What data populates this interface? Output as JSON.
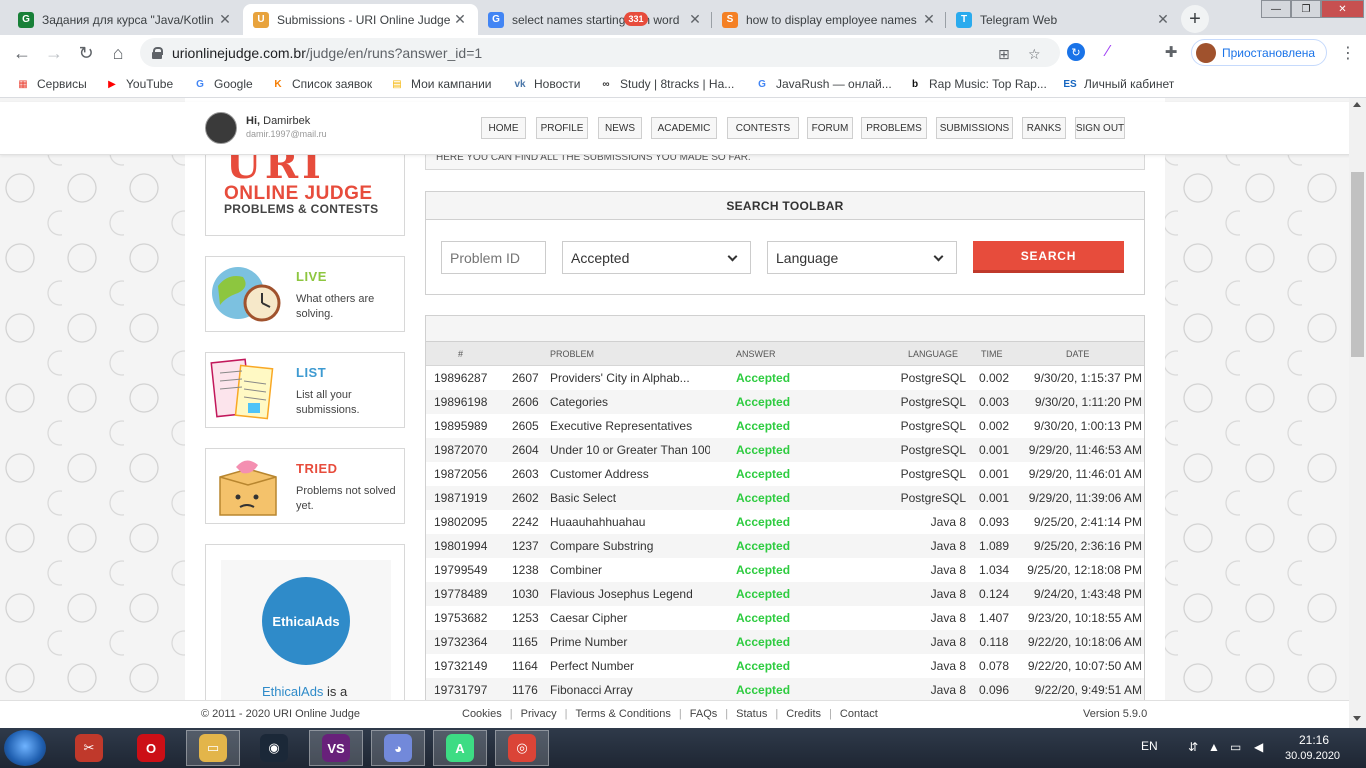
{
  "browser": {
    "tabs": [
      {
        "title": "Задания для курса \"Java/Kotlin",
        "fav": "G",
        "color": "#188038",
        "active": false
      },
      {
        "title": "Submissions - URI Online Judge",
        "fav": "U",
        "color": "#e8a33d",
        "active": true
      },
      {
        "title": "select names starting with word",
        "fav": "G",
        "color": "#4285f4",
        "active": false
      },
      {
        "title": "how to display employee names",
        "fav": "S",
        "color": "#f48024",
        "active": false
      },
      {
        "title": "Telegram Web",
        "fav": "T",
        "color": "#2aabee",
        "active": false
      }
    ],
    "url_host": "urionlinejudge.com.br",
    "url_path": "/judge/en/runs?answer_id=1",
    "profile_label": "Приостановлена",
    "bookmarks": [
      {
        "label": "Сервисы",
        "icon": "apps-grid-icon",
        "glyph": "▦",
        "color": "#ea4335"
      },
      {
        "label": "YouTube",
        "icon": "youtube-icon",
        "glyph": "▶",
        "color": "#ff0000"
      },
      {
        "label": "Google",
        "icon": "google-icon",
        "glyph": "G",
        "color": "#4285f4"
      },
      {
        "label": "Список заявок",
        "icon": "k-icon",
        "glyph": "K",
        "color": "#f57c00"
      },
      {
        "label": "Мои кампании",
        "icon": "campaign-icon",
        "glyph": "▤",
        "color": "#f4b400"
      },
      {
        "label": "Новости",
        "icon": "vk-icon",
        "glyph": "vk",
        "color": "#4a76a8"
      },
      {
        "label": "Study | 8tracks | Ha...",
        "icon": "8tracks-icon",
        "glyph": "∞",
        "color": "#333333"
      },
      {
        "label": "JavaRush — онлай...",
        "icon": "google-icon",
        "glyph": "G",
        "color": "#4285f4"
      },
      {
        "label": "Rap Music: Top Rap...",
        "icon": "b-icon",
        "glyph": "b",
        "color": "#111111"
      },
      {
        "label": "Личный кабинет",
        "icon": "es-icon",
        "glyph": "ES",
        "color": "#1565c0"
      }
    ]
  },
  "header": {
    "greeting": "Hi,",
    "user_name": "Damirbek",
    "email": "damir.1997@mail.ru",
    "nav": [
      "HOME",
      "PROFILE",
      "NEWS",
      "ACADEMIC",
      "CONTESTS",
      "FORUM",
      "PROBLEMS",
      "SUBMISSIONS",
      "RANKS",
      "SIGN OUT"
    ],
    "news_badge": "331"
  },
  "logo": {
    "top": "URI",
    "line1": "ONLINE JUDGE",
    "line2": "PROBLEMS & CONTESTS"
  },
  "side_cards": [
    {
      "title": "LIVE",
      "desc": "What others are solving.",
      "color": "#8dc63f"
    },
    {
      "title": "LIST",
      "desc": "List all your submissions.",
      "color": "#3d9ad1"
    },
    {
      "title": "TRIED",
      "desc": "Problems not solved yet.",
      "color": "#e74c3c"
    }
  ],
  "ad": {
    "logo_text": "EthicalAds",
    "link": "EthicalAds",
    "suffix": " is a"
  },
  "intro_text": "HERE YOU CAN FIND ALL THE SUBMISSIONS YOU MADE SO FAR.",
  "search": {
    "title": "SEARCH TOOLBAR",
    "problem_placeholder": "Problem ID",
    "answer_value": "Accepted",
    "language_value": "Language",
    "button": "SEARCH"
  },
  "table": {
    "headers": {
      "id": "#",
      "problem": "PROBLEM",
      "answer": "ANSWER",
      "language": "LANGUAGE",
      "time": "TIME",
      "date": "DATE"
    },
    "rows": [
      {
        "id": "19896287",
        "num": "2607",
        "name": "Providers' City in Alphab...",
        "answer": "Accepted",
        "lang": "PostgreSQL",
        "time": "0.002",
        "date": "9/30/20, 1:15:37 PM"
      },
      {
        "id": "19896198",
        "num": "2606",
        "name": "Categories",
        "answer": "Accepted",
        "lang": "PostgreSQL",
        "time": "0.003",
        "date": "9/30/20, 1:11:20 PM"
      },
      {
        "id": "19895989",
        "num": "2605",
        "name": "Executive Representatives",
        "answer": "Accepted",
        "lang": "PostgreSQL",
        "time": "0.002",
        "date": "9/30/20, 1:00:13 PM"
      },
      {
        "id": "19872070",
        "num": "2604",
        "name": "Under 10 or Greater Than 100",
        "answer": "Accepted",
        "lang": "PostgreSQL",
        "time": "0.001",
        "date": "9/29/20, 11:46:53 AM"
      },
      {
        "id": "19872056",
        "num": "2603",
        "name": "Customer Address",
        "answer": "Accepted",
        "lang": "PostgreSQL",
        "time": "0.001",
        "date": "9/29/20, 11:46:01 AM"
      },
      {
        "id": "19871919",
        "num": "2602",
        "name": "Basic Select",
        "answer": "Accepted",
        "lang": "PostgreSQL",
        "time": "0.001",
        "date": "9/29/20, 11:39:06 AM"
      },
      {
        "id": "19802095",
        "num": "2242",
        "name": "Huaauhahhuahau",
        "answer": "Accepted",
        "lang": "Java 8",
        "time": "0.093",
        "date": "9/25/20, 2:41:14 PM"
      },
      {
        "id": "19801994",
        "num": "1237",
        "name": "Compare Substring",
        "answer": "Accepted",
        "lang": "Java 8",
        "time": "1.089",
        "date": "9/25/20, 2:36:16 PM"
      },
      {
        "id": "19799549",
        "num": "1238",
        "name": "Combiner",
        "answer": "Accepted",
        "lang": "Java 8",
        "time": "1.034",
        "date": "9/25/20, 12:18:08 PM"
      },
      {
        "id": "19778489",
        "num": "1030",
        "name": "Flavious Josephus Legend",
        "answer": "Accepted",
        "lang": "Java 8",
        "time": "0.124",
        "date": "9/24/20, 1:43:48 PM"
      },
      {
        "id": "19753682",
        "num": "1253",
        "name": "Caesar Cipher",
        "answer": "Accepted",
        "lang": "Java 8",
        "time": "1.407",
        "date": "9/23/20, 10:18:55 AM"
      },
      {
        "id": "19732364",
        "num": "1165",
        "name": "Prime Number",
        "answer": "Accepted",
        "lang": "Java 8",
        "time": "0.118",
        "date": "9/22/20, 10:18:06 AM"
      },
      {
        "id": "19732149",
        "num": "1164",
        "name": "Perfect Number",
        "answer": "Accepted",
        "lang": "Java 8",
        "time": "0.078",
        "date": "9/22/20, 10:07:50 AM"
      },
      {
        "id": "19731797",
        "num": "1176",
        "name": "Fibonacci Array",
        "answer": "Accepted",
        "lang": "Java 8",
        "time": "0.096",
        "date": "9/22/20, 9:49:51 AM"
      }
    ]
  },
  "footer": {
    "copyright": "© 2011 - 2020 URI Online Judge",
    "links": [
      "Cookies",
      "Privacy",
      "Terms & Conditions",
      "FAQs",
      "Status",
      "Credits",
      "Contact"
    ],
    "version": "Version 5.9.0"
  },
  "taskbar": {
    "apps": [
      {
        "name": "paint-icon",
        "glyph": "✂",
        "color": "#c0392b"
      },
      {
        "name": "opera-icon",
        "glyph": "O",
        "color": "#cc0f16"
      },
      {
        "name": "file-explorer-icon",
        "glyph": "▭",
        "color": "#e3b54a"
      },
      {
        "name": "steam-icon",
        "glyph": "◉",
        "color": "#1b2838"
      },
      {
        "name": "visual-studio-icon",
        "glyph": "VS",
        "color": "#68217a"
      },
      {
        "name": "discord-icon",
        "glyph": "◕",
        "color": "#7289da"
      },
      {
        "name": "android-studio-icon",
        "glyph": "A",
        "color": "#3ddc84"
      },
      {
        "name": "chrome-icon",
        "glyph": "◎",
        "color": "#db4437"
      }
    ],
    "lang": "EN",
    "time": "21:16",
    "date": "30.09.2020"
  }
}
